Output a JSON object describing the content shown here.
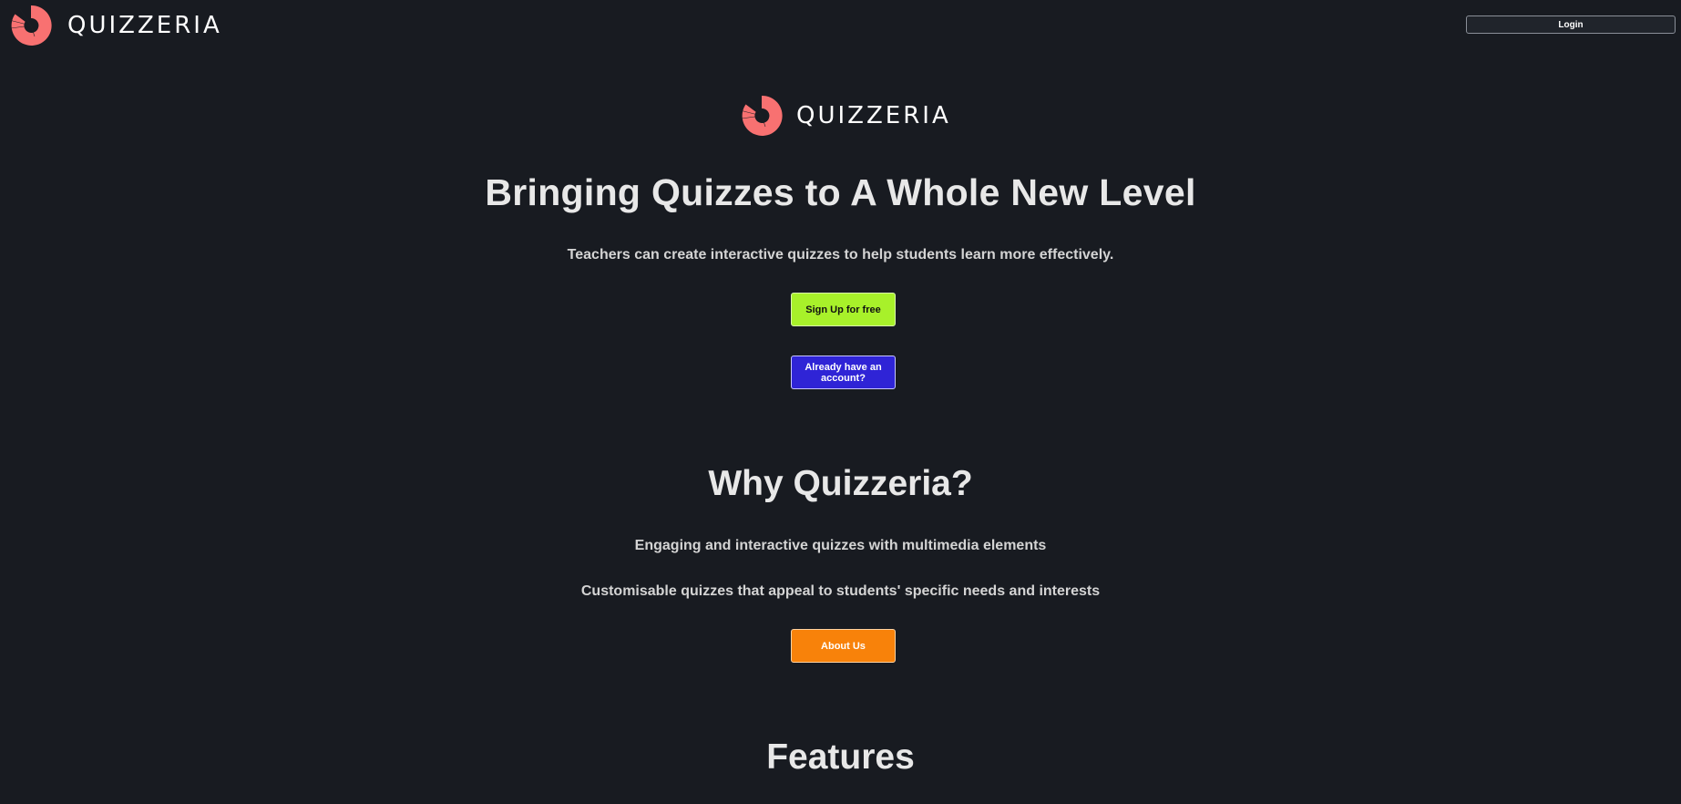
{
  "header": {
    "brand": "QUIZZERIA",
    "login_label": "Login"
  },
  "hero": {
    "brand": "QUIZZERIA",
    "title": "Bringing Quizzes to A Whole New Level",
    "subtitle": "Teachers can create interactive quizzes to help students learn more effectively.",
    "signup_label": "Sign Up for free",
    "account_label": "Already have an account?"
  },
  "why": {
    "title": "Why Quizzeria?",
    "points": [
      "Engaging and interactive quizzes with multimedia elements",
      "Customisable quizzes that appeal to students' specific needs and interests"
    ],
    "about_label": "About Us"
  },
  "features": {
    "title": "Features"
  },
  "colors": {
    "background": "#181b21",
    "logo": "#f87171",
    "signup_button": "#a8f12a",
    "account_button": "#2f24d6",
    "about_button": "#f8820a"
  },
  "icons": {
    "logo": "quizzeria-logo-icon"
  }
}
